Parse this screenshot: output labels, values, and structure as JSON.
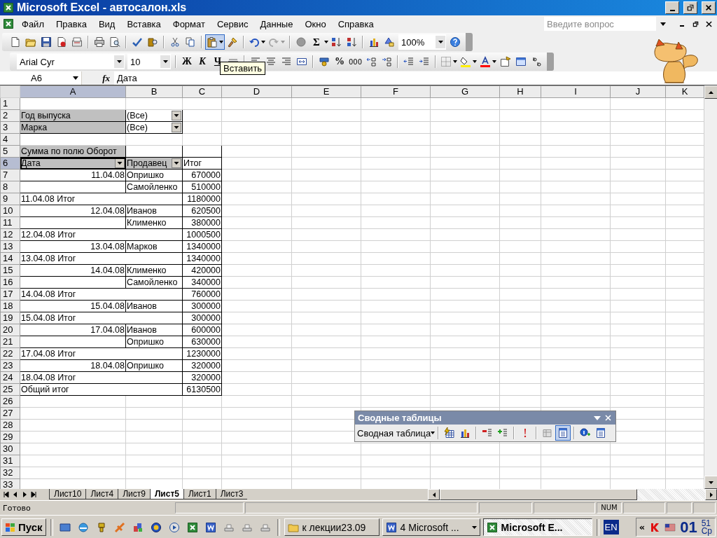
{
  "window": {
    "title": "Microsoft Excel - автосалон.xls"
  },
  "menu": [
    "Файл",
    "Правка",
    "Вид",
    "Вставка",
    "Формат",
    "Сервис",
    "Данные",
    "Окно",
    "Справка"
  ],
  "help_box": {
    "placeholder": "Введите вопрос"
  },
  "toolbar": {
    "sum_symbol": "Σ",
    "zoom": "100%",
    "paste_pressed": true
  },
  "formatting": {
    "font": "Arial Cyr",
    "size": "10",
    "bold": "Ж",
    "italic": "К",
    "underline": "Ч",
    "percent": "%",
    "thousands": "000"
  },
  "tooltip": "Вставить",
  "formula_bar": {
    "name_box": "A6",
    "function_label": "fx",
    "formula": "Дата"
  },
  "sheet": {
    "columns": [
      {
        "label": "A",
        "selected": true
      },
      {
        "label": "B",
        "selected": false
      },
      {
        "label": "C",
        "selected": false
      },
      {
        "label": "D",
        "selected": false
      },
      {
        "label": "E",
        "selected": false
      },
      {
        "label": "F",
        "selected": false
      },
      {
        "label": "G",
        "selected": false
      },
      {
        "label": "H",
        "selected": false
      },
      {
        "label": "I",
        "selected": false
      },
      {
        "label": "J",
        "selected": false
      },
      {
        "label": "K",
        "selected": false
      }
    ],
    "rows": [
      {
        "number": "1",
        "selected": false
      },
      {
        "number": "2",
        "selected": false,
        "cells": [
          {
            "kind": "page-field",
            "text": "Год выпуска"
          },
          {
            "kind": "filter",
            "text": "(Все)"
          }
        ]
      },
      {
        "number": "3",
        "selected": false,
        "cells": [
          {
            "kind": "page-field",
            "text": "Марка"
          },
          {
            "kind": "filter",
            "text": "(Все)"
          }
        ]
      },
      {
        "number": "4",
        "selected": false
      },
      {
        "number": "5",
        "selected": false,
        "cells": [
          {
            "kind": "caption",
            "text": "Сумма по полю Оборот"
          },
          {
            "kind": "blank"
          },
          {
            "kind": "blank"
          }
        ]
      },
      {
        "number": "6",
        "selected": true,
        "cells": [
          {
            "kind": "field",
            "text": "Дата",
            "active": true
          },
          {
            "kind": "field",
            "text": "Продавец"
          },
          {
            "kind": "label",
            "text": "Итог"
          }
        ]
      },
      {
        "number": "7",
        "selected": false,
        "cells": [
          {
            "kind": "date",
            "text": "11.04.08"
          },
          {
            "kind": "label",
            "text": "Опришко"
          },
          {
            "kind": "number",
            "text": "670000"
          }
        ]
      },
      {
        "number": "8",
        "selected": false,
        "cells": [
          {
            "kind": "continued"
          },
          {
            "kind": "label",
            "text": "Самойленко"
          },
          {
            "kind": "number",
            "text": "510000"
          }
        ]
      },
      {
        "number": "9",
        "selected": false,
        "cells": [
          {
            "kind": "total",
            "text": "11.04.08 Итог"
          },
          {
            "kind": "number",
            "text": "1180000"
          }
        ]
      },
      {
        "number": "10",
        "selected": false,
        "cells": [
          {
            "kind": "date",
            "text": "12.04.08"
          },
          {
            "kind": "label",
            "text": "Иванов"
          },
          {
            "kind": "number",
            "text": "620500"
          }
        ]
      },
      {
        "number": "11",
        "selected": false,
        "cells": [
          {
            "kind": "continued"
          },
          {
            "kind": "label",
            "text": "Клименко"
          },
          {
            "kind": "number",
            "text": "380000"
          }
        ]
      },
      {
        "number": "12",
        "selected": false,
        "cells": [
          {
            "kind": "total",
            "text": "12.04.08 Итог"
          },
          {
            "kind": "number",
            "text": "1000500"
          }
        ]
      },
      {
        "number": "13",
        "selected": false,
        "cells": [
          {
            "kind": "date",
            "text": "13.04.08"
          },
          {
            "kind": "label",
            "text": "Марков"
          },
          {
            "kind": "number",
            "text": "1340000"
          }
        ]
      },
      {
        "number": "14",
        "selected": false,
        "cells": [
          {
            "kind": "total",
            "text": "13.04.08 Итог"
          },
          {
            "kind": "number",
            "text": "1340000"
          }
        ]
      },
      {
        "number": "15",
        "selected": false,
        "cells": [
          {
            "kind": "date",
            "text": "14.04.08"
          },
          {
            "kind": "label",
            "text": "Клименко"
          },
          {
            "kind": "number",
            "text": "420000"
          }
        ]
      },
      {
        "number": "16",
        "selected": false,
        "cells": [
          {
            "kind": "continued"
          },
          {
            "kind": "label",
            "text": "Самойленко"
          },
          {
            "kind": "number",
            "text": "340000"
          }
        ]
      },
      {
        "number": "17",
        "selected": false,
        "cells": [
          {
            "kind": "total",
            "text": "14.04.08 Итог"
          },
          {
            "kind": "number",
            "text": "760000"
          }
        ]
      },
      {
        "number": "18",
        "selected": false,
        "cells": [
          {
            "kind": "date",
            "text": "15.04.08"
          },
          {
            "kind": "label",
            "text": "Иванов"
          },
          {
            "kind": "number",
            "text": "300000"
          }
        ]
      },
      {
        "number": "19",
        "selected": false,
        "cells": [
          {
            "kind": "total",
            "text": "15.04.08 Итог"
          },
          {
            "kind": "number",
            "text": "300000"
          }
        ]
      },
      {
        "number": "20",
        "selected": false,
        "cells": [
          {
            "kind": "date",
            "text": "17.04.08"
          },
          {
            "kind": "label",
            "text": "Иванов"
          },
          {
            "kind": "number",
            "text": "600000"
          }
        ]
      },
      {
        "number": "21",
        "selected": false,
        "cells": [
          {
            "kind": "continued"
          },
          {
            "kind": "label",
            "text": "Опришко"
          },
          {
            "kind": "number",
            "text": "630000"
          }
        ]
      },
      {
        "number": "22",
        "selected": false,
        "cells": [
          {
            "kind": "total",
            "text": "17.04.08 Итог"
          },
          {
            "kind": "number",
            "text": "1230000"
          }
        ]
      },
      {
        "number": "23",
        "selected": false,
        "cells": [
          {
            "kind": "date",
            "text": "18.04.08"
          },
          {
            "kind": "label",
            "text": "Опришко"
          },
          {
            "kind": "number",
            "text": "320000"
          }
        ]
      },
      {
        "number": "24",
        "selected": false,
        "cells": [
          {
            "kind": "total",
            "text": "18.04.08 Итог"
          },
          {
            "kind": "number",
            "text": "320000"
          }
        ]
      },
      {
        "number": "25",
        "selected": false,
        "cells": [
          {
            "kind": "total",
            "text": "Общий итог"
          },
          {
            "kind": "number",
            "text": "6130500"
          }
        ]
      },
      {
        "number": "26",
        "selected": false
      },
      {
        "number": "27",
        "selected": false
      },
      {
        "number": "28",
        "selected": false
      },
      {
        "number": "29",
        "selected": false
      },
      {
        "number": "30",
        "selected": false
      },
      {
        "number": "31",
        "selected": false
      },
      {
        "number": "32",
        "selected": false
      },
      {
        "number": "33",
        "selected": false
      }
    ]
  },
  "sheet_tabs": [
    {
      "label": "Лист10",
      "selected": false
    },
    {
      "label": "Лист4",
      "selected": false
    },
    {
      "label": "Лист9",
      "selected": false
    },
    {
      "label": "Лист5",
      "selected": true
    },
    {
      "label": "Лист1",
      "selected": false
    },
    {
      "label": "Лист3",
      "selected": false
    }
  ],
  "status_bar": {
    "status": "Готово",
    "num": "NUM"
  },
  "pivot_toolbar": {
    "title": "Сводные таблицы",
    "menu": "Сводная таблица",
    "always_display_pressed": true
  },
  "taskbar": {
    "start": "Пуск",
    "tasks": [
      {
        "label": "к лекции23.09",
        "kind": "folder",
        "selected": false
      },
      {
        "label": "4 Microsoft ...",
        "kind": "word",
        "selected": false
      },
      {
        "label": "Microsoft E...",
        "kind": "excel",
        "selected": true
      }
    ],
    "language": "EN",
    "tray_expand": "«",
    "clock": {
      "hour": "01",
      "minute": "51",
      "day": "Ср"
    }
  }
}
